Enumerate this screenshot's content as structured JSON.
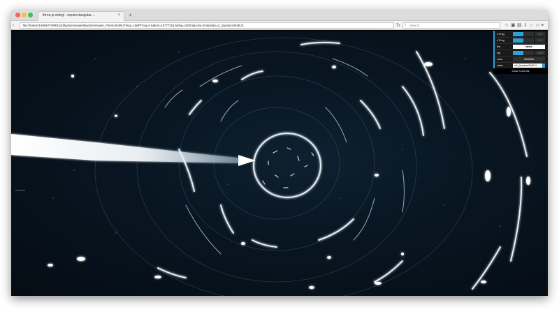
{
  "browser": {
    "tab_title": "three.js webgl - equirectangular ...",
    "tab_close": "×",
    "new_tab": "+",
    "url": "file:///Users/JUWeb/THREE.js/Skydome/ease/Skydome/Aware_Points.html#UTImg=1.5&PTImg=0.5&trim=18777215.5&fog=1000.5&color=0.5&video=3_Quantum2548.21",
    "search_placeholder": "Search",
    "reload_glyph": "↻",
    "back_glyph": "‹",
    "forward_glyph": "›",
    "toolbar_glyphs": [
      "☆",
      "▣",
      "▤",
      "⇩",
      "⌂",
      "☺",
      "≡"
    ]
  },
  "gui": {
    "rows": [
      {
        "label": "uTImg",
        "type": "slider",
        "value": "1.5",
        "fill_fraction": 0.5
      },
      {
        "label": "uTImg",
        "type": "slider",
        "value": "0.5",
        "fill_fraction": 0.5
      },
      {
        "label": "tint",
        "type": "input-white",
        "value": "white"
      },
      {
        "label": "fog",
        "type": "slider",
        "value": "1000",
        "fill_fraction": 0.5
      },
      {
        "label": "color",
        "type": "input",
        "value": "#000000"
      },
      {
        "label": "video",
        "type": "select",
        "value": "vid_Quantum2548.21"
      }
    ],
    "close_label": "Close Controls",
    "accent": "#2fa1d6",
    "background": "#1a1a1a"
  },
  "icons": {
    "crosshair": "crosshair-icon"
  }
}
